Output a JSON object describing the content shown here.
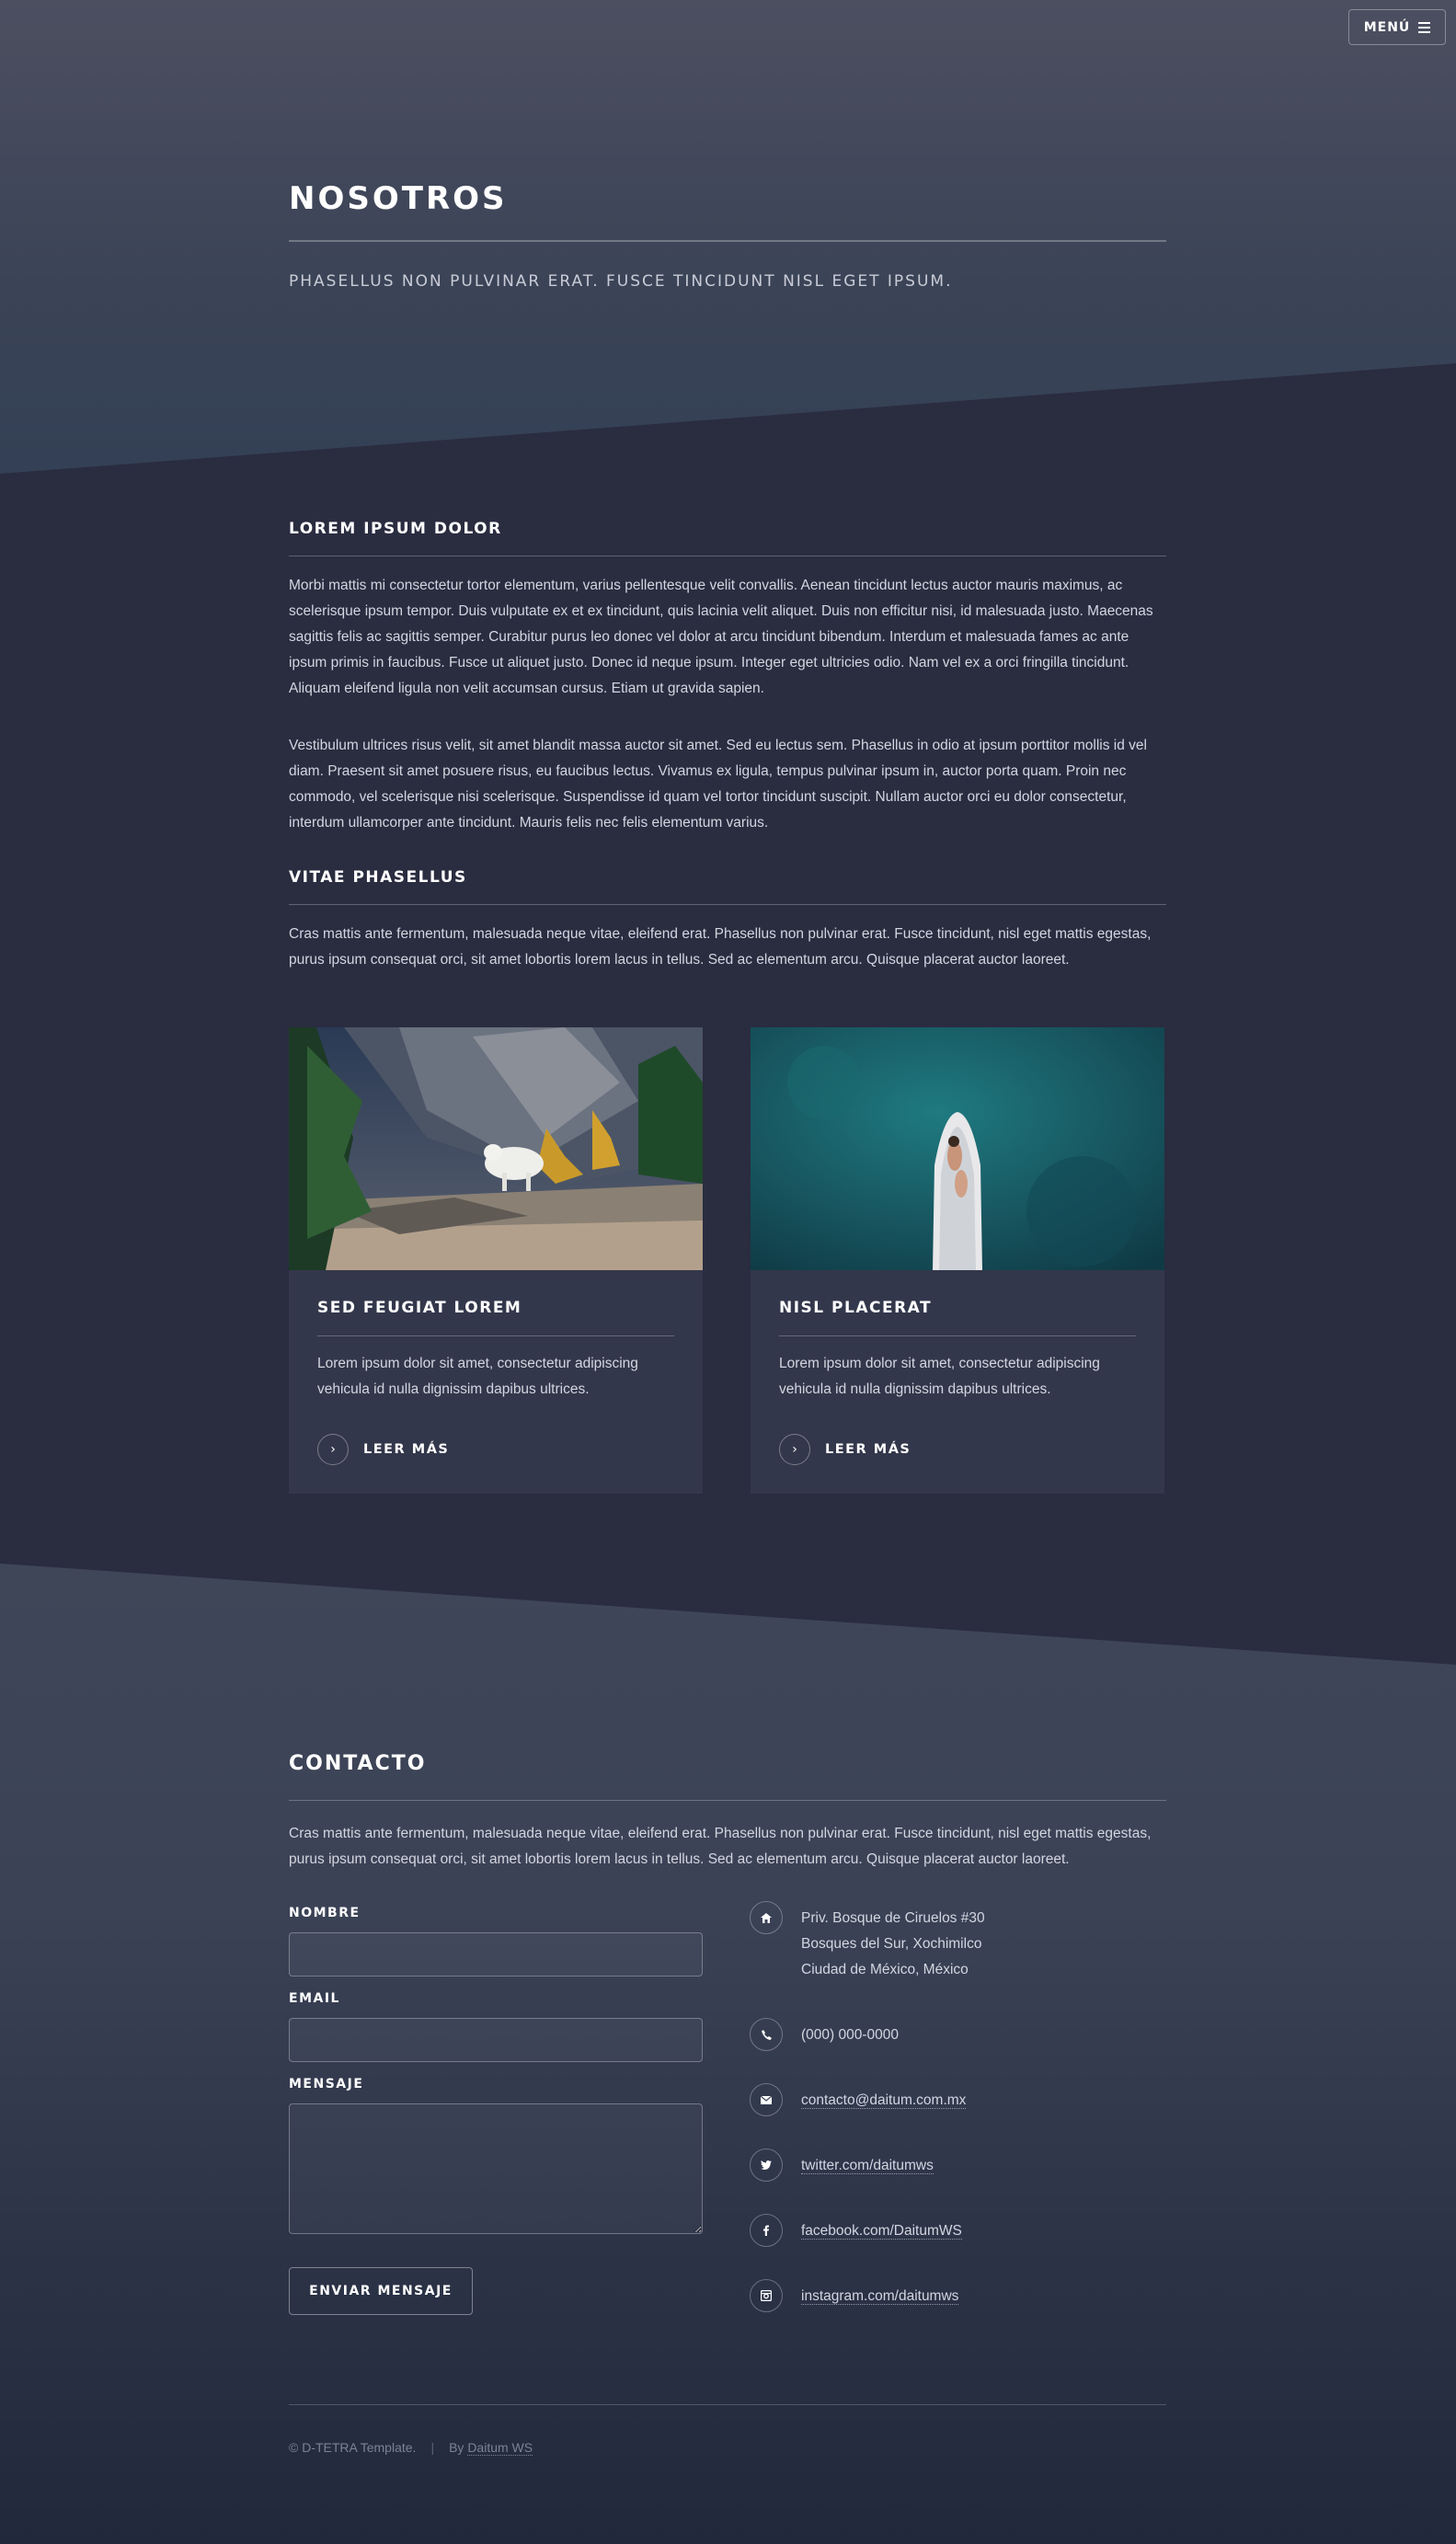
{
  "header": {
    "menu_label": "MENÚ",
    "title": "NOSOTROS",
    "subtitle": "PHASELLUS NON PULVINAR ERAT. FUSCE TINCIDUNT NISL EGET IPSUM."
  },
  "about": {
    "heading1": "LOREM IPSUM DOLOR",
    "para1": "Morbi mattis mi consectetur tortor elementum, varius pellentesque velit convallis. Aenean tincidunt lectus auctor mauris maximus, ac scelerisque ipsum tempor. Duis vulputate ex et ex tincidunt, quis lacinia velit aliquet. Duis non efficitur nisi, id malesuada justo. Maecenas sagittis felis ac sagittis semper. Curabitur purus leo donec vel dolor at arcu tincidunt bibendum. Interdum et malesuada fames ac ante ipsum primis in faucibus. Fusce ut aliquet justo. Donec id neque ipsum. Integer eget ultricies odio. Nam vel ex a orci fringilla tincidunt. Aliquam eleifend ligula non velit accumsan cursus. Etiam ut gravida sapien.",
    "para2": "Vestibulum ultrices risus velit, sit amet blandit massa auctor sit amet. Sed eu lectus sem. Phasellus in odio at ipsum porttitor mollis id vel diam. Praesent sit amet posuere risus, eu faucibus lectus. Vivamus ex ligula, tempus pulvinar ipsum in, auctor porta quam. Proin nec commodo, vel scelerisque nisi scelerisque. Suspendisse id quam vel tortor tincidunt suscipit. Nullam auctor orci eu dolor consectetur, interdum ullamcorper ante tincidunt. Mauris felis nec felis elementum varius.",
    "heading2": "VITAE PHASELLUS",
    "para3": "Cras mattis ante fermentum, malesuada neque vitae, eleifend erat. Phasellus non pulvinar erat. Fusce tincidunt, nisl eget mattis egestas, purus ipsum consequat orci, sit amet lobortis lorem lacus in tellus. Sed ac elementum arcu. Quisque placerat auctor laoreet."
  },
  "cards": [
    {
      "title": "SED FEUGIAT LOREM",
      "text": "Lorem ipsum dolor sit amet, consectetur adipiscing vehicula id nulla dignissim dapibus ultrices.",
      "link": "LEER MÁS"
    },
    {
      "title": "NISL PLACERAT",
      "text": "Lorem ipsum dolor sit amet, consectetur adipiscing vehicula id nulla dignissim dapibus ultrices.",
      "link": "LEER MÁS"
    }
  ],
  "contact": {
    "heading": "CONTACTO",
    "intro": "Cras mattis ante fermentum, malesuada neque vitae, eleifend erat. Phasellus non pulvinar erat. Fusce tincidunt, nisl eget mattis egestas, purus ipsum consequat orci, sit amet lobortis lorem lacus in tellus. Sed ac elementum arcu. Quisque placerat auctor laoreet.",
    "form": {
      "name_label": "NOMBRE",
      "name_value": "",
      "email_label": "EMAIL",
      "email_value": "",
      "message_label": "MENSAJE",
      "message_value": "",
      "submit_label": "ENVIAR MENSAJE"
    },
    "address": {
      "line1": "Priv. Bosque de Ciruelos #30",
      "line2": "Bosques del Sur, Xochimilco",
      "line3": "Ciudad de México, México"
    },
    "phone": "(000) 000-0000",
    "email": "contacto@daitum.com.mx",
    "twitter": "twitter.com/daitumws",
    "facebook": "facebook.com/DaitumWS",
    "instagram": "instagram.com/daitumws"
  },
  "footer": {
    "copyright": "© D-TETRA Template.",
    "separator": "|",
    "by_prefix": "By",
    "by_link": "Daitum WS"
  },
  "icons": {
    "menu": "hamburger-icon",
    "read_more": "chevron-right-icon",
    "address": "home-icon",
    "phone": "phone-icon",
    "email": "envelope-icon",
    "twitter": "twitter-icon",
    "facebook": "facebook-icon",
    "instagram": "instagram-icon"
  },
  "colors": {
    "background": "#2a2c40",
    "card": "#33374b",
    "text": "#d3d6e0",
    "heading": "#ffffff"
  }
}
